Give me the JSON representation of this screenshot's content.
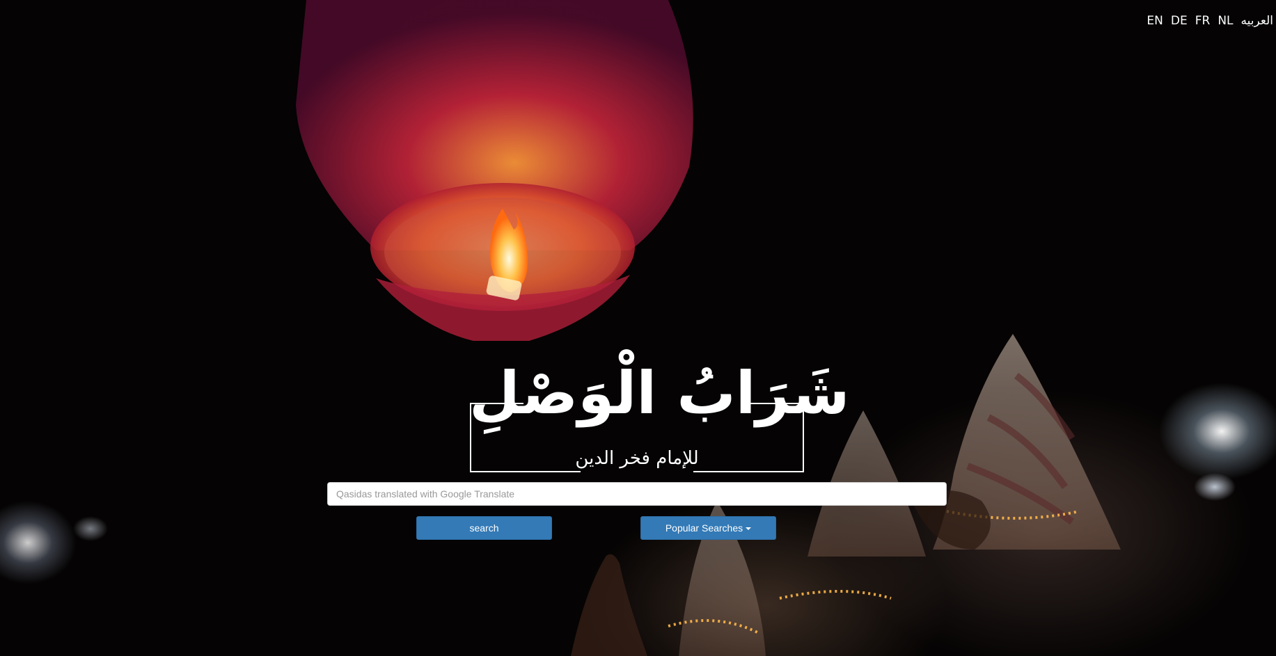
{
  "languages": [
    "EN",
    "DE",
    "FR",
    "NL",
    "العربيه"
  ],
  "logo": {
    "title": "شَرَابُ الْوَصْلِ",
    "subtitle": "للإمام فخر الدين"
  },
  "search": {
    "placeholder": "Qasidas translated with Google Translate",
    "value": ""
  },
  "buttons": {
    "search_label": "search",
    "popular_label": "Popular Searches"
  },
  "colors": {
    "button_primary": "#337ab7",
    "text_on_dark": "#ffffff"
  }
}
